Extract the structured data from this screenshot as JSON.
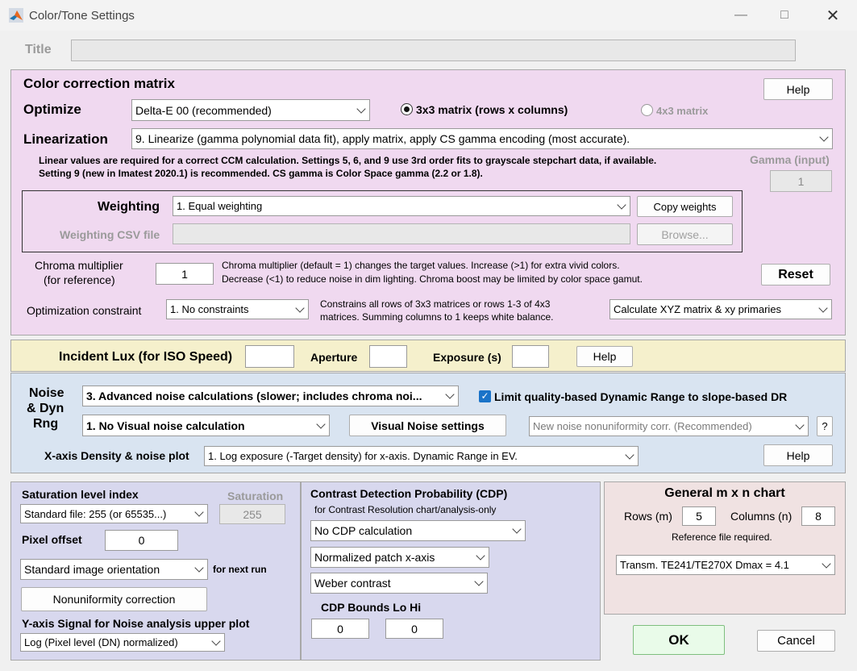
{
  "window": {
    "title": "Color/Tone Settings"
  },
  "title_field": {
    "label": "Title",
    "value": ""
  },
  "ccm": {
    "heading": "Color correction matrix",
    "help": "Help",
    "optimize_label": "Optimize",
    "optimize_value": "Delta-E 00    (recommended)",
    "matrix3_label": "3x3 matrix  (rows x columns)",
    "matrix4_label": "4x3 matrix",
    "linearization_label": "Linearization",
    "linearization_value": "9.   Linearize (gamma polynomial data fit), apply matrix, apply CS gamma encoding  (most accurate).",
    "note_line1": "Linear values are required for a correct CCM calculation.  Settings 5, 6, and 9 use 3rd order fits to grayscale stepchart data, if available.",
    "note_line2": "Setting 9 (new in Imatest 2020.1) is recommended.  CS gamma is Color Space gamma (2.2 or 1.8).",
    "gamma_label": "Gamma (input)",
    "gamma_value": "1",
    "weighting_label": "Weighting",
    "weighting_value": "1.  Equal weighting",
    "copy_weights": "Copy weights",
    "weighting_csv_label": "Weighting CSV file",
    "weighting_csv_value": "",
    "browse": "Browse...",
    "chroma_label_1": "Chroma multiplier",
    "chroma_label_2": "(for reference)",
    "chroma_value": "1",
    "chroma_note_1": "Chroma multiplier (default = 1) changes the target values. Increase (>1) for extra vivid colors.",
    "chroma_note_2": "Decrease (<1) to reduce noise in dim lighting. Chroma boost may be limited by color space gamut.",
    "reset": "Reset",
    "constraint_label": "Optimization constraint",
    "constraint_value": "1. No constraints",
    "constraint_note_1": "Constrains all rows of 3x3 matrices or rows 1-3 of 4x3",
    "constraint_note_2": "matrices. Summing columns to 1 keeps white balance.",
    "xyz_value": "Calculate XYZ matrix & xy primaries"
  },
  "iso": {
    "lux_label": "Incident Lux (for ISO Speed)",
    "lux_value": "",
    "aperture_label": "Aperture",
    "aperture_value": "",
    "exposure_label": "Exposure (s)",
    "exposure_value": "",
    "help": "Help"
  },
  "noise": {
    "label_1": "Noise",
    "label_2": "& Dyn",
    "label_3": "Rng",
    "calc_value": "3. Advanced noise calculations (slower; includes chroma noi...",
    "limit_label": "Limit quality-based Dynamic Range to slope-based DR",
    "limit_checked": true,
    "visual_value": "1.  No Visual noise calculation",
    "visual_settings": "Visual Noise settings",
    "nonuniformity_value": "New noise nonuniformity corr. (Recommended)",
    "question": "?",
    "xaxis_label": "X-axis Density & noise plot",
    "xaxis_value": "1. Log exposure (-Target density) for x-axis.     Dynamic Range in EV.",
    "help": "Help"
  },
  "saturation": {
    "label": "Saturation level index",
    "value": "Standard file:  255 (or 65535...)",
    "sat_label": "Saturation",
    "sat_value": "255",
    "pixel_offset_label": "Pixel offset",
    "pixel_offset_value": "0",
    "orientation_value": "Standard image orientation",
    "for_next_run": "for next run",
    "nonuniformity_button": "Nonuniformity correction",
    "yaxis_label": "Y-axis Signal for Noise analysis upper plot",
    "yaxis_value": "Log (Pixel level (DN)  normalized)"
  },
  "cdp": {
    "heading": "Contrast Detection Probability (CDP)",
    "subheading": "for Contrast Resolution chart/analysis-only",
    "calc_value": "No CDP calculation",
    "xaxis_value": "Normalized patch x-axis",
    "contrast_value": "Weber contrast",
    "bounds_label": "CDP Bounds Lo Hi",
    "lo_value": "0",
    "hi_value": "0"
  },
  "general": {
    "heading": "General m x n chart",
    "rows_label": "Rows (m)",
    "rows_value": "5",
    "cols_label": "Columns (n)",
    "cols_value": "8",
    "ref_note": "Reference file required.",
    "ref_value": "Transm. TE241/TE270X Dmax = 4.1"
  },
  "footer": {
    "ok": "OK",
    "cancel": "Cancel"
  },
  "icons": [
    "matlab-icon",
    "minimize-icon",
    "maximize-icon",
    "close-icon",
    "chevron-down-icon",
    "radio-icon",
    "checkbox-icon"
  ]
}
